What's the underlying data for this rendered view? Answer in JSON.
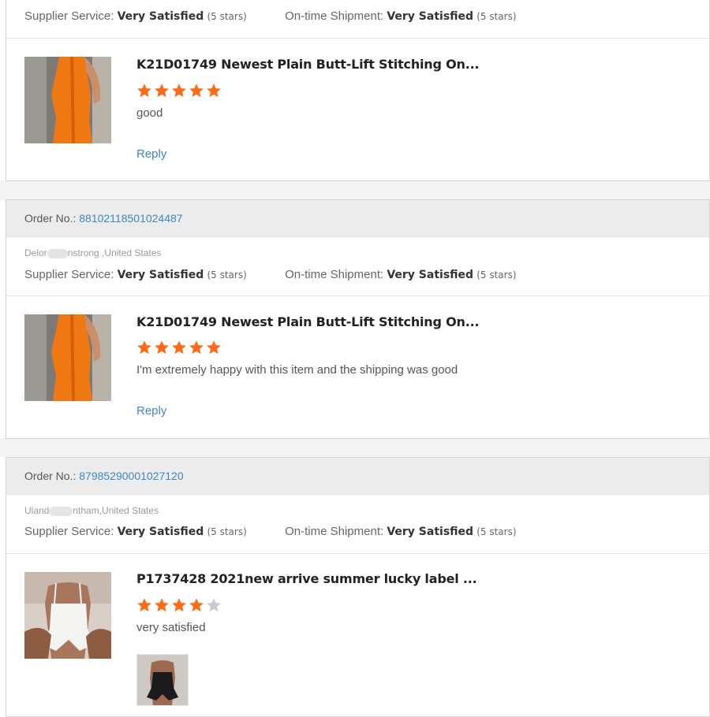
{
  "colors": {
    "link": "#3d87c4",
    "star_on": "#ff6a14",
    "star_off": "#c9c9d1",
    "header_bg": "#ececec"
  },
  "top_card": {
    "supplier_label": "Supplier Service:",
    "supplier_value": "Very Satisfied",
    "supplier_stars": "(5 stars)",
    "shipment_label": "On-time Shipment:",
    "shipment_value": "Very Satisfied",
    "shipment_stars": "(5 stars)",
    "product_title": "K21D01749 Newest Plain Butt-Lift Stitching On...",
    "rating": 5,
    "review": "good",
    "reply": "Reply"
  },
  "reviews": [
    {
      "order_label": "Order No.:",
      "order_no": "88102118501024487",
      "buyer_a": "Delor",
      "buyer_b": "nstrong ,United States",
      "supplier_label": "Supplier Service:",
      "supplier_value": "Very Satisfied",
      "supplier_stars": "(5 stars)",
      "shipment_label": "On-time Shipment:",
      "shipment_value": "Very Satisfied",
      "shipment_stars": "(5 stars)",
      "product_title": "K21D01749 Newest Plain Butt-Lift Stitching On...",
      "rating": 5,
      "review": "I'm extremely happy with this item and the shipping was good",
      "reply": "Reply"
    },
    {
      "order_label": "Order No.:",
      "order_no": "87985290001027120",
      "buyer_a": "Uland",
      "buyer_b": "ntham,United States",
      "supplier_label": "Supplier Service:",
      "supplier_value": "Very Satisfied",
      "supplier_stars": "(5 stars)",
      "shipment_label": "On-time Shipment:",
      "shipment_value": "Very Satisfied",
      "shipment_stars": "(5 stars)",
      "product_title": "P1737428 2021new arrive summer lucky label ...",
      "rating": 4,
      "review": "very satisfied"
    }
  ]
}
